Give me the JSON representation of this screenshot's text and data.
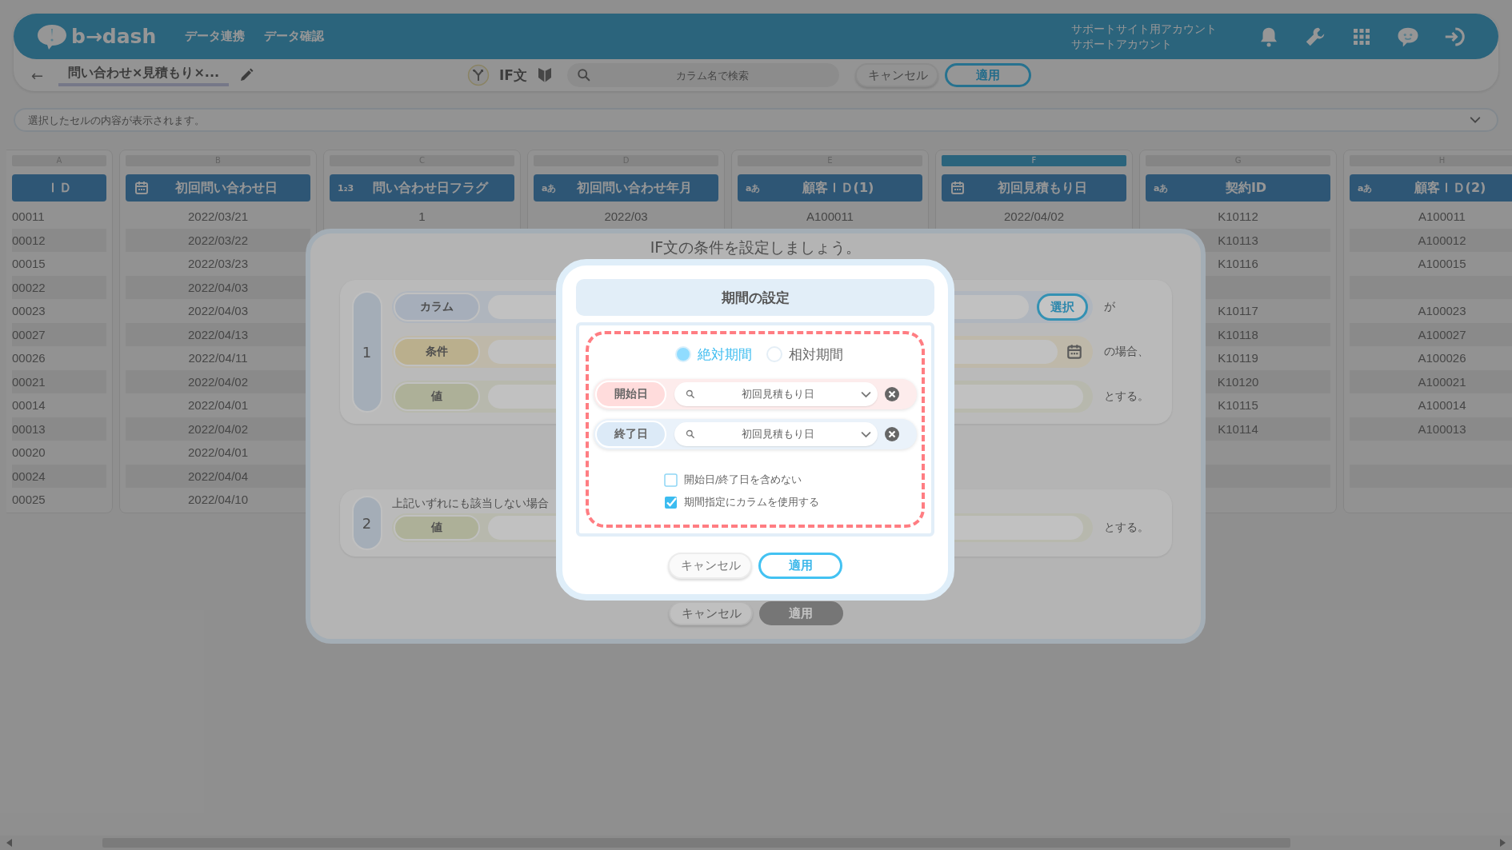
{
  "header": {
    "logo": "b→dash",
    "nav": [
      {
        "label": "データ連携"
      },
      {
        "label": "データ確認"
      }
    ],
    "account": {
      "line_1": "サポートサイト用アカウント",
      "line_2": "サポートアカウント"
    }
  },
  "toolbar": {
    "back": "←",
    "title": "問い合わせ×見積もり×...",
    "mode": "IF文",
    "search": {
      "placeholder": "カラム名で検索"
    },
    "buttons": [
      {
        "label": "キャンセル",
        "kind": "plain"
      },
      {
        "label": "適用",
        "kind": "primary"
      }
    ]
  },
  "cell_content": {
    "placeholder": "選択したセルの内容が表示されます。"
  },
  "table": {
    "columns": [
      {
        "letter": "A",
        "name": "ＩＤ",
        "selected": false,
        "cells": [
          "00011",
          "00012",
          "00015",
          "00022",
          "00023",
          "00027",
          "00026",
          "00021",
          "00014",
          "00013",
          "00020",
          "00024",
          "00025"
        ]
      },
      {
        "letter": "B",
        "name": "初回問い合わせ日",
        "kind": "date",
        "selected": false,
        "cells": [
          "2022/03/21",
          "2022/03/22",
          "2022/03/23",
          "2022/04/03",
          "2022/04/03",
          "2022/04/13",
          "2022/04/11",
          "2022/04/02",
          "2022/04/01",
          "2022/04/02",
          "2022/04/01",
          "2022/04/04",
          "2022/04/10"
        ]
      },
      {
        "letter": "C",
        "name": "問い合わせ日フラグ",
        "kind": "number",
        "type_label": "1₂3",
        "selected": false,
        "cells": [
          "1"
        ]
      },
      {
        "letter": "D",
        "name": "初回問い合わせ年月",
        "kind": "text",
        "type_label": "aあ",
        "selected": false,
        "cells": [
          "2022/03"
        ]
      },
      {
        "letter": "E",
        "name": "顧客ＩＤ(1)",
        "kind": "text",
        "type_label": "aあ",
        "selected": false,
        "cells": [
          "A100011"
        ]
      },
      {
        "letter": "F",
        "name": "初回見積もり日",
        "kind": "date",
        "selected": true,
        "cells": [
          "2022/04/02"
        ]
      },
      {
        "letter": "G",
        "name": "契約ID",
        "kind": "text",
        "type_label": "aあ",
        "selected": false,
        "cells": [
          "K10112",
          "K10113",
          "K10116",
          null,
          "K10117",
          "K10118",
          "K10119",
          "K10120",
          "K10115",
          "K10114",
          null,
          null,
          null
        ]
      },
      {
        "letter": "H",
        "name": "顧客ＩＤ(2)",
        "kind": "text",
        "type_label": "aあ",
        "selected": false,
        "cells": [
          "A100011",
          "A100012",
          "A100015",
          null,
          "A100023",
          "A100027",
          "A100026",
          "A100021",
          "A100014",
          "A100013",
          null,
          null,
          null
        ]
      }
    ]
  },
  "if_dialog": {
    "title": "IF文の条件を設定しましょう。",
    "conditions": [
      {
        "number": "1",
        "rows": [
          {
            "kind": "column",
            "label": "カラム",
            "button": "選択",
            "suffix": "が"
          },
          {
            "kind": "condition",
            "label": "条件",
            "suffix": "の場合、"
          },
          {
            "kind": "value",
            "label": "値",
            "suffix": "とする。"
          }
        ]
      },
      {
        "number": "2",
        "note": "上記いずれにも該当しない場合",
        "rows": [
          {
            "kind": "value",
            "label": "値",
            "suffix": "とする。"
          }
        ]
      }
    ],
    "buttons": [
      {
        "label": "キャンセル",
        "kind": "plain"
      },
      {
        "label": "適用",
        "kind": "filled"
      }
    ]
  },
  "period_dialog": {
    "title": "期間の設定",
    "modes": [
      {
        "label": "絶対期間",
        "selected": true
      },
      {
        "label": "相対期間",
        "selected": false
      }
    ],
    "ranges": [
      {
        "kind": "start",
        "label": "開始日",
        "value": "初回見積もり日"
      },
      {
        "kind": "end",
        "label": "終了日",
        "value": "初回見積もり日"
      }
    ],
    "options": [
      {
        "label": "開始日/終了日を含めない",
        "checked": false
      },
      {
        "label": "期間指定にカラムを使用する",
        "checked": true
      }
    ],
    "buttons": [
      {
        "label": "キャンセル",
        "kind": "plain"
      },
      {
        "label": "適用",
        "kind": "primary"
      }
    ]
  }
}
